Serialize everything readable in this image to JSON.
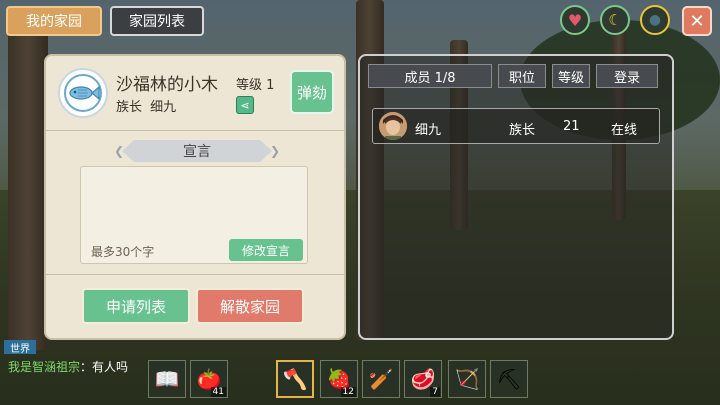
{
  "tabs": {
    "my_home": "我的家园",
    "home_list": "家园列表"
  },
  "top_icons": [
    {
      "name": "heart-icon",
      "glyph": "♥",
      "color": "#e05a6a"
    },
    {
      "name": "banana-icon",
      "glyph": "☾",
      "color": "#e8c53a"
    },
    {
      "name": "water-drop-icon",
      "glyph": "●",
      "color": "#2f4b5a"
    }
  ],
  "close": "✕",
  "home": {
    "name": "沙福林的小木",
    "level_label": "等级 1",
    "leader_label": "族长",
    "leader_name": "细九",
    "impeach_button": "弹劾",
    "declaration_title": "宣言",
    "declaration_placeholder": "最多30个字",
    "edit_declaration_button": "修改宣言",
    "apply_list_button": "申请列表",
    "disband_button": "解散家园"
  },
  "members": {
    "headers": {
      "member": "成员 1/8",
      "role": "职位",
      "level": "等级",
      "login": "登录"
    },
    "rows": [
      {
        "name": "细九",
        "role": "族长",
        "level": "21",
        "status": "在线"
      }
    ]
  },
  "chat": {
    "channel": "世界",
    "user": "我是智涵祖宗",
    "message": "：有人吗"
  },
  "hotbar": [
    {
      "name": "book-item",
      "glyph": "📖",
      "count": ""
    },
    {
      "name": "tomato-item",
      "glyph": "🍅",
      "count": "41"
    },
    {
      "name": "stone-axe-item",
      "glyph": "🪓",
      "count": ""
    },
    {
      "name": "strawberry-item",
      "glyph": "🍓",
      "count": "12"
    },
    {
      "name": "club-item",
      "glyph": "🏏",
      "count": ""
    },
    {
      "name": "meat-item",
      "glyph": "🥩",
      "count": "7"
    },
    {
      "name": "bow-item",
      "glyph": "🏹",
      "count": ""
    },
    {
      "name": "pickaxe-item",
      "glyph": "⛏",
      "count": ""
    }
  ]
}
